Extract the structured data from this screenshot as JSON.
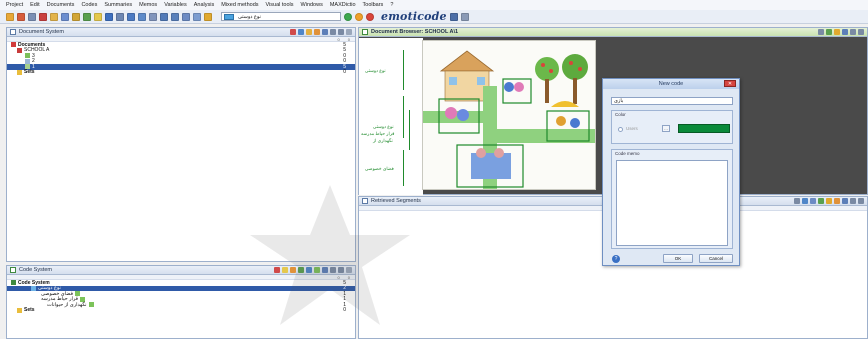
{
  "menu": [
    "Project",
    "Edit",
    "Documents",
    "Codes",
    "Summaries",
    "Memos",
    "Variables",
    "Analysis",
    "Mixed methods",
    "Visual tools",
    "Windows",
    "MAXDictio",
    "Toolbars",
    "?"
  ],
  "toolbar": {
    "code_select_value": "نوع دوستی",
    "brand": "emoticode"
  },
  "document_system": {
    "title": "Document System",
    "col": [
      "0",
      "0"
    ],
    "rows": [
      {
        "label": "Documents",
        "count": "5",
        "bold": true
      },
      {
        "label": "SCHOOL A",
        "count": "5",
        "bold": false
      },
      {
        "label": "3",
        "count": "0",
        "bold": false
      },
      {
        "label": "2",
        "count": "0",
        "bold": false
      },
      {
        "label": "1",
        "count": "5",
        "bold": false
      },
      {
        "label": "Sets",
        "count": "0",
        "bold": true
      }
    ]
  },
  "code_system": {
    "title": "Code System",
    "col": [
      "0",
      "0"
    ],
    "rows": [
      {
        "label": "Code System",
        "count": "5",
        "bold": true
      },
      {
        "label": "نوع دوستی",
        "count": "2",
        "bold": false
      },
      {
        "label": "فضای خصوصی",
        "count": "1",
        "bold": false
      },
      {
        "label": "قرار حیاط مدرسه",
        "count": "1",
        "bold": false
      },
      {
        "label": "نگهداری از حیوانات",
        "count": "1",
        "bold": false
      },
      {
        "label": "Sets",
        "count": "0",
        "bold": true
      }
    ]
  },
  "document_browser": {
    "title": "Document Browser: SCHOOL A\\1",
    "codes": [
      "نوع دوستی",
      "نوع دوستی",
      "قرار حیاط مدرسه",
      "نگهداری از",
      "فضای خصوصی"
    ]
  },
  "retrieved": {
    "title": "Retrieved Segments"
  },
  "dialog": {
    "title": "New code",
    "name_value": "بازی",
    "color_label": "Color",
    "color_radio_label": "Users",
    "color_value": "#0a8a3a",
    "memo_label": "Code memo",
    "ok_label": "OK",
    "cancel_label": "Cancel"
  },
  "colors": {
    "accent": "#2f5aa8",
    "doc_title_bg": "#c9e2b1",
    "selection": "#2f5aa8",
    "code_green": "#1f8a2c"
  }
}
